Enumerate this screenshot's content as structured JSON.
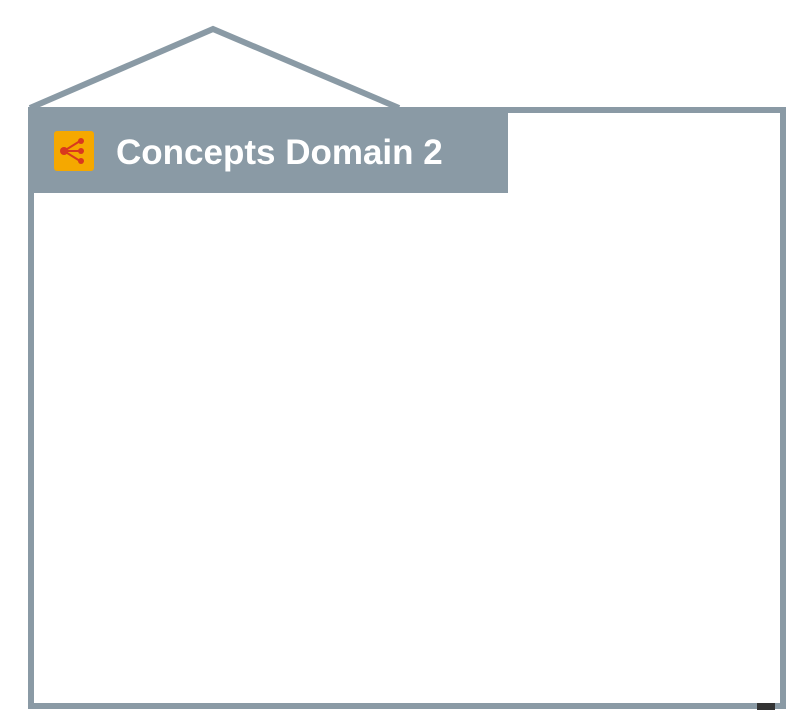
{
  "domain": {
    "title": "Concepts Domain 2",
    "icon": "concepts-domain-icon"
  },
  "colors": {
    "frame": "#8a9aa5",
    "title_text": "#ffffff",
    "icon_background": "#f5a800",
    "icon_accent": "#d9381e"
  }
}
